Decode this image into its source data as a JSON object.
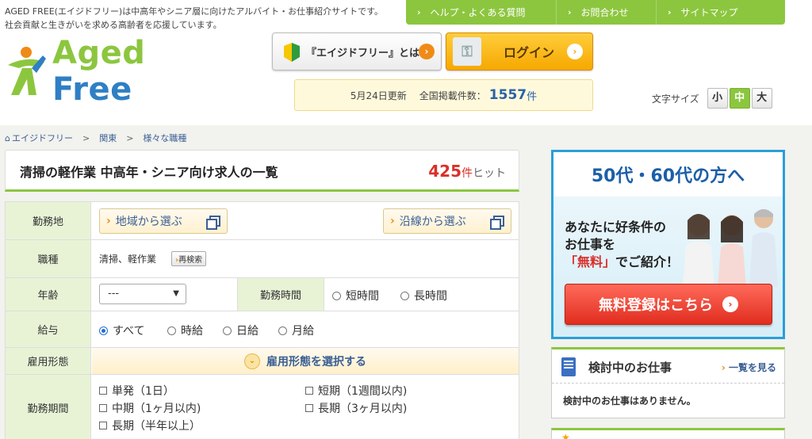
{
  "header": {
    "tagline_1": "AGED FREE(エイジドフリー)は中高年やシニア層に向けたアルバイト・お仕事紹介サイトです。",
    "tagline_2": "社会貢献と生きがいを求める高齢者を応援しています。",
    "nav": [
      {
        "label": "ヘルプ・よくある質問"
      },
      {
        "label": "お問合わせ"
      },
      {
        "label": "サイトマップ"
      }
    ],
    "logo_text_a": "Aged",
    "logo_text_b": "Free",
    "about_label": "『エイジドフリー』とは",
    "login_label": "ログイン",
    "update_date": "5月24日更新",
    "listings_label": "全国掲載件数：",
    "listings_count": "1557",
    "listings_unit": "件",
    "fontsize_label": "文字サイズ",
    "fontsize_options": [
      "小",
      "中",
      "大"
    ],
    "fontsize_selected": "中"
  },
  "breadcrumb": [
    "エイジドフリー",
    "関東",
    "様々な職種"
  ],
  "title": {
    "heading": "清掃の軽作業 中高年・シニア向け求人の一覧",
    "hit_count": "425",
    "hit_unit": "件",
    "hit_label": "ヒット"
  },
  "search": {
    "location_label": "勤務地",
    "region_button": "地域から選ぶ",
    "line_button": "沿線から選ぶ",
    "job_type_label": "職種",
    "job_type_value": "清掃、軽作業",
    "research_button": "再検索",
    "age_label": "年齢",
    "age_value": "---",
    "hours_label": "勤務時間",
    "hours_options": [
      "短時間",
      "長時間"
    ],
    "pay_label": "給与",
    "pay_options": [
      "すべて",
      "時給",
      "日給",
      "月給"
    ],
    "pay_selected": "すべて",
    "employment_label": "雇用形態",
    "employment_button": "雇用形態を選択する",
    "period_label": "勤務期間",
    "period_options": [
      "単発（1日）",
      "短期（1週間以内)",
      "中期（1ヶ月以内)",
      "長期（3ヶ月以内)",
      "長期（半年以上）"
    ]
  },
  "banner": {
    "heading": "50代・60代の方へ",
    "copy_1": "あなたに好条件の",
    "copy_2": "お仕事を",
    "copy_3_red": "「無料」",
    "copy_3": "でご紹介！",
    "cta": "無料登録はこちら"
  },
  "favorites": {
    "title": "検討中のお仕事",
    "more": "一覧を見る",
    "empty_message": "検討中のお仕事はありません。"
  },
  "colors": {
    "brand_green": "#8cc63f",
    "brand_blue": "#2f7fc4",
    "accent_orange": "#f6a800",
    "hit_red": "#d9302a"
  }
}
